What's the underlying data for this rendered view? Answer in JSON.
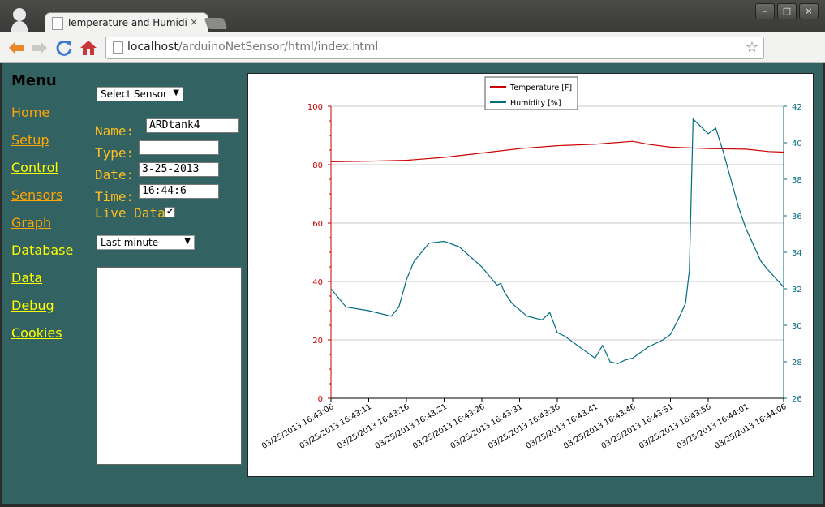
{
  "browser": {
    "tab_title": "Temperature and Humidi",
    "tab_close": "×",
    "url_host": "localhost",
    "url_path": "/arduinoNetSensor/html/index.html",
    "window_buttons": [
      "–",
      "□",
      "×"
    ],
    "nav_icons": [
      "back-arrow-icon",
      "forward-arrow-icon",
      "reload-icon",
      "home-icon"
    ]
  },
  "menu": {
    "title": "Menu",
    "items": [
      {
        "label": "Home",
        "color": "#ffa500"
      },
      {
        "label": "Setup",
        "color": "#ffa500"
      },
      {
        "label": "Control",
        "color": "#ffff00"
      },
      {
        "label": "Sensors",
        "color": "#ffa500"
      },
      {
        "label": "Graph",
        "color": "#ffa500"
      },
      {
        "label": "Database",
        "color": "#ffff00"
      },
      {
        "label": "Data",
        "color": "#ffff00"
      },
      {
        "label": "Debug",
        "color": "#ffff00"
      },
      {
        "label": "Cookies",
        "color": "#ffff00"
      }
    ]
  },
  "sensor": {
    "select_label": "Select Sensor",
    "name_label": "Name:",
    "name_value": "ARDtank4",
    "type_label": "Type:",
    "type_value": "",
    "date_label": "Date:",
    "date_value": "3-25-2013",
    "time_label": "Time:",
    "time_value": "16:44:6",
    "live_label": "Live Data",
    "live_checked": true,
    "range_label": "Last minute"
  },
  "chart_data": {
    "type": "line",
    "legend": [
      "Temperature [F]",
      "Humidity [%]"
    ],
    "legend_position": "top-center",
    "grid": true,
    "x_tick_labels": [
      "03/25/2013 16:43:06",
      "03/25/2013 16:43:11",
      "03/25/2013 16:43:16",
      "03/25/2013 16:43:21",
      "03/25/2013 16:43:26",
      "03/25/2013 16:43:31",
      "03/25/2013 16:43:36",
      "03/25/2013 16:43:41",
      "03/25/2013 16:43:46",
      "03/25/2013 16:43:51",
      "03/25/2013 16:43:56",
      "03/25/2013 16:44:01",
      "03/25/2013 16:44:06"
    ],
    "x_range": [
      0,
      60
    ],
    "y_left": {
      "min": 0,
      "max": 100,
      "ticks": [
        0,
        20,
        40,
        60,
        80,
        100
      ],
      "color": "#cc0000"
    },
    "y_right": {
      "min": 26,
      "max": 42,
      "ticks": [
        26,
        28,
        30,
        32,
        34,
        36,
        38,
        40,
        42
      ],
      "color": "#006b80"
    },
    "series": [
      {
        "name": "Temperature [F]",
        "axis": "left",
        "color": "#cc0000",
        "x": [
          0,
          5,
          10,
          15,
          20,
          25,
          30,
          35,
          40,
          42,
          45,
          50,
          55,
          58,
          60
        ],
        "y": [
          81,
          81.2,
          81.5,
          82.5,
          84,
          85.5,
          86.5,
          87,
          88,
          87,
          86,
          85.5,
          85.3,
          84.5,
          84.3
        ]
      },
      {
        "name": "Humidity [%]",
        "axis": "right",
        "color": "#006b80",
        "x": [
          0,
          2,
          5,
          8,
          9,
          10,
          11,
          12,
          13,
          15,
          17,
          20,
          22,
          22.5,
          23,
          24,
          26,
          28,
          29,
          30,
          31,
          34,
          35,
          36,
          37,
          38,
          39,
          40,
          42,
          44,
          45,
          46,
          47,
          47.5,
          48,
          50,
          51,
          52,
          53,
          54,
          55,
          57,
          58,
          60
        ],
        "y": [
          32,
          31,
          30.8,
          30.5,
          31,
          32.5,
          33.5,
          34,
          34.5,
          34.6,
          34.3,
          33.2,
          32.2,
          32.3,
          31.8,
          31.2,
          30.5,
          30.3,
          30.7,
          29.6,
          29.4,
          28.5,
          28.2,
          28.9,
          28,
          27.9,
          28.1,
          28.2,
          28.8,
          29.2,
          29.5,
          30.3,
          31.2,
          33,
          41.3,
          40.5,
          40.8,
          39.5,
          38,
          36.5,
          35.3,
          33.5,
          33,
          32.1
        ]
      }
    ]
  }
}
